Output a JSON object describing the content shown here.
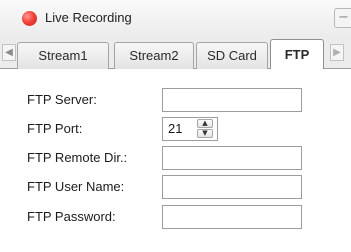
{
  "window": {
    "title": "Live Recording",
    "minimize_glyph": "−"
  },
  "icons": {
    "record": "record-dot-icon",
    "tab_scroll_left": "left-arrow-icon",
    "tab_scroll_right": "right-arrow-icon",
    "spin_up": "up-arrow-icon",
    "spin_down": "down-arrow-icon"
  },
  "icon_glyphs": {
    "left": "◀",
    "right": "▶",
    "up": "▲",
    "down": "▼"
  },
  "tabs": [
    {
      "label": "Stream1",
      "active": false
    },
    {
      "label": "Stream2",
      "active": false
    },
    {
      "label": "SD Card",
      "active": false
    },
    {
      "label": "FTP",
      "active": true
    }
  ],
  "form": {
    "server": {
      "label": "FTP Server:",
      "value": ""
    },
    "port": {
      "label": "FTP Port:",
      "value": "21"
    },
    "remote_dir": {
      "label": "FTP Remote Dir.:",
      "value": ""
    },
    "user_name": {
      "label": "FTP User Name:",
      "value": ""
    },
    "password": {
      "label": "FTP Password:",
      "value": ""
    }
  },
  "colors": {
    "record_red": "#e8352d",
    "tab_border": "#a4a4a4",
    "field_border": "#9c9c9c"
  }
}
